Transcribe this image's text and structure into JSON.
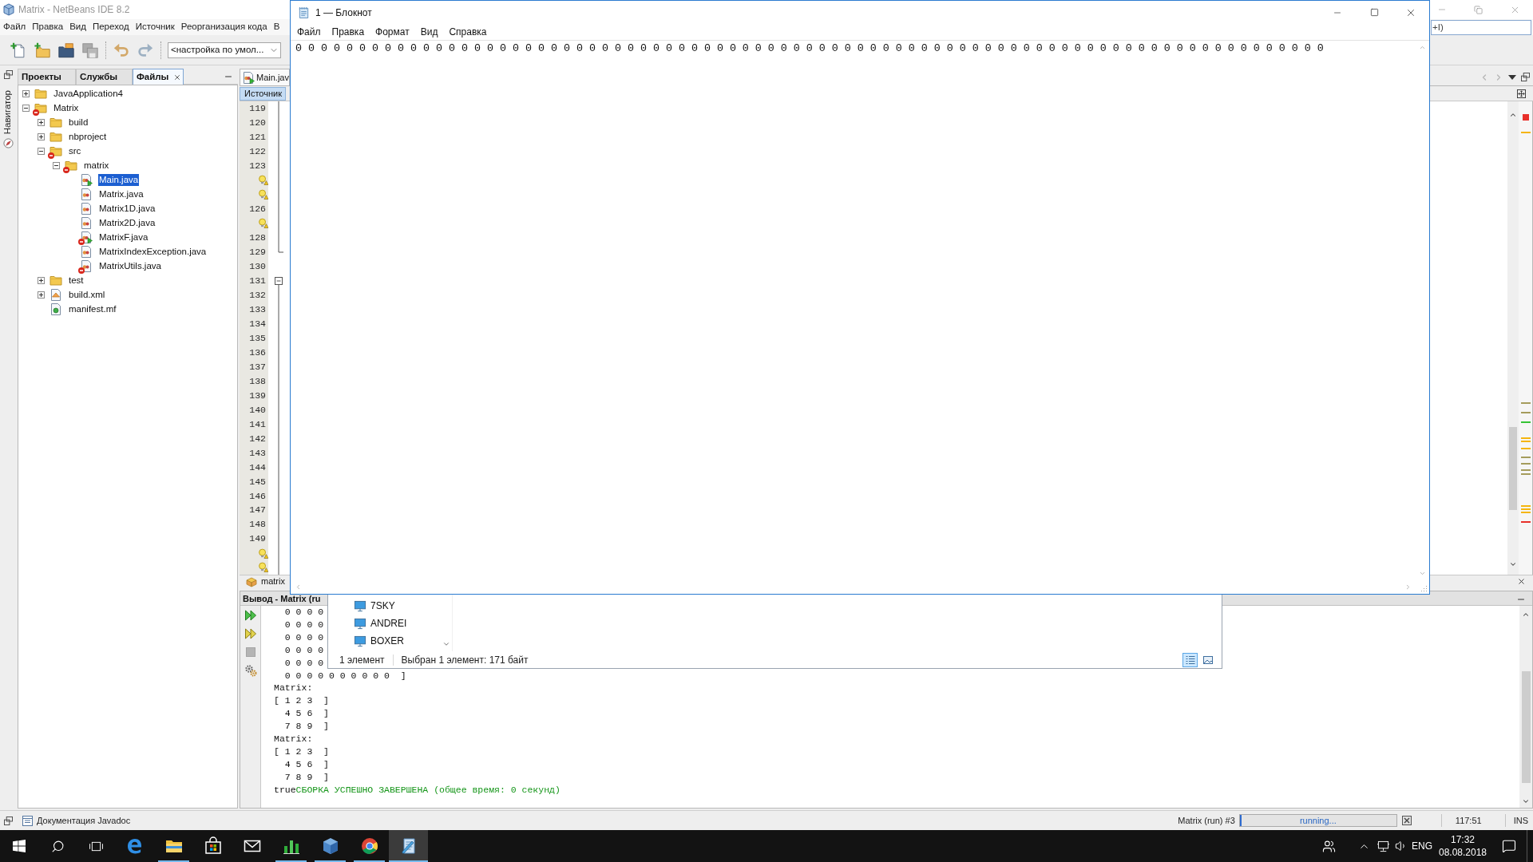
{
  "ide": {
    "title": "Matrix - NetBeans IDE 8.2",
    "menu": [
      "Файл",
      "Правка",
      "Вид",
      "Переход",
      "Источник",
      "Реорганизация кода",
      "В"
    ],
    "toolbar": {
      "buttons": [
        {
          "kind": "new-file",
          "disabled": false
        },
        {
          "kind": "new-project",
          "disabled": false
        },
        {
          "kind": "open-project",
          "disabled": false
        },
        {
          "kind": "save-all",
          "disabled": true
        },
        {
          "kind": "undo",
          "disabled": false
        },
        {
          "kind": "redo",
          "disabled": false
        }
      ],
      "configuration": "<настройка по умол..."
    },
    "search": {
      "placeholder": "+I)"
    },
    "side_tabs": [
      "Навигатор"
    ],
    "project_tabs": [
      {
        "label": "Проекты",
        "selected": false,
        "closable": false
      },
      {
        "label": "Службы",
        "selected": false,
        "closable": false
      },
      {
        "label": "Файлы",
        "selected": true,
        "closable": true
      }
    ],
    "tree": [
      {
        "label": "JavaApplication4",
        "kind": "folder",
        "expanded": false,
        "error": false,
        "selected": false
      },
      {
        "label": "Matrix",
        "kind": "folder",
        "expanded": true,
        "error": true,
        "selected": false,
        "children": [
          {
            "label": "build",
            "kind": "folder",
            "expanded": false,
            "error": false,
            "selected": false
          },
          {
            "label": "nbproject",
            "kind": "folder",
            "expanded": false,
            "error": false,
            "selected": false
          },
          {
            "label": "src",
            "kind": "folder",
            "expanded": true,
            "error": true,
            "selected": false,
            "children": [
              {
                "label": "matrix",
                "kind": "folder",
                "expanded": true,
                "error": true,
                "selected": false,
                "children": [
                  {
                    "label": "Main.java",
                    "kind": "java-main",
                    "error": false,
                    "selected": true
                  },
                  {
                    "label": "Matrix.java",
                    "kind": "java",
                    "error": false,
                    "selected": false
                  },
                  {
                    "label": "Matrix1D.java",
                    "kind": "java",
                    "error": false,
                    "selected": false
                  },
                  {
                    "label": "Matrix2D.java",
                    "kind": "java",
                    "error": false,
                    "selected": false
                  },
                  {
                    "label": "MatrixF.java",
                    "kind": "java-main",
                    "error": true,
                    "selected": false
                  },
                  {
                    "label": "MatrixIndexException.java",
                    "kind": "java",
                    "error": false,
                    "selected": false
                  },
                  {
                    "label": "MatrixUtils.java",
                    "kind": "java",
                    "error": true,
                    "selected": false
                  }
                ]
              }
            ]
          },
          {
            "label": "test",
            "kind": "folder",
            "expanded": false,
            "error": false,
            "selected": false
          },
          {
            "label": "build.xml",
            "kind": "xml",
            "expanded": false,
            "error": false,
            "selected": false
          },
          {
            "label": "manifest.mf",
            "kind": "manifest",
            "error": false,
            "selected": false
          }
        ]
      }
    ],
    "editor": {
      "file_tab": "Main.jav",
      "view_tab": {
        "label": "Источник",
        "selected": true
      },
      "gutter": [
        {
          "kind": "number",
          "text": "119"
        },
        {
          "kind": "number",
          "text": "120"
        },
        {
          "kind": "number",
          "text": "121"
        },
        {
          "kind": "number",
          "text": "122"
        },
        {
          "kind": "number",
          "text": "123"
        },
        {
          "kind": "hint"
        },
        {
          "kind": "hint"
        },
        {
          "kind": "number",
          "text": "126"
        },
        {
          "kind": "hint"
        },
        {
          "kind": "number",
          "text": "128"
        },
        {
          "kind": "number",
          "text": "129"
        },
        {
          "kind": "number",
          "text": "130"
        },
        {
          "kind": "number",
          "text": "131"
        },
        {
          "kind": "number",
          "text": "132"
        },
        {
          "kind": "number",
          "text": "133"
        },
        {
          "kind": "number",
          "text": "134"
        },
        {
          "kind": "number",
          "text": "135"
        },
        {
          "kind": "number",
          "text": "136"
        },
        {
          "kind": "number",
          "text": "137"
        },
        {
          "kind": "number",
          "text": "138"
        },
        {
          "kind": "number",
          "text": "139"
        },
        {
          "kind": "number",
          "text": "140"
        },
        {
          "kind": "number",
          "text": "141"
        },
        {
          "kind": "number",
          "text": "142"
        },
        {
          "kind": "number",
          "text": "143"
        },
        {
          "kind": "number",
          "text": "144"
        },
        {
          "kind": "number",
          "text": "145"
        },
        {
          "kind": "number",
          "text": "146"
        },
        {
          "kind": "number",
          "text": "147"
        },
        {
          "kind": "number",
          "text": "148"
        },
        {
          "kind": "number",
          "text": "149"
        },
        {
          "kind": "hint"
        },
        {
          "kind": "hint"
        }
      ],
      "breadcrumb": "matrix"
    },
    "output": {
      "title": "Вывод - Matrix (ru",
      "tools": [
        {
          "kind": "rerun",
          "disabled": false
        },
        {
          "kind": "rerun-custom",
          "disabled": false
        },
        {
          "kind": "stop",
          "disabled": true
        },
        {
          "kind": "settings",
          "disabled": false
        }
      ],
      "lines": [
        {
          "kind": "plain",
          "text": "  0 0 0 0"
        },
        {
          "kind": "plain",
          "text": "  0 0 0 0"
        },
        {
          "kind": "plain",
          "text": "  0 0 0 0"
        },
        {
          "kind": "plain",
          "text": "  0 0 0 0"
        },
        {
          "kind": "plain",
          "text": "  0 0 0 0"
        },
        {
          "kind": "plain",
          "text": "  0 0 0 0 0 0 0 0 0 0  ]"
        },
        {
          "kind": "plain",
          "text": "Matrix:"
        },
        {
          "kind": "plain",
          "text": "[ 1 2 3  ]"
        },
        {
          "kind": "plain",
          "text": "  4 5 6  ]"
        },
        {
          "kind": "plain",
          "text": "  7 8 9  ]"
        },
        {
          "kind": "plain",
          "text": "Matrix:"
        },
        {
          "kind": "plain",
          "text": "[ 1 2 3  ]"
        },
        {
          "kind": "plain",
          "text": "  4 5 6  ]"
        },
        {
          "kind": "plain",
          "text": "  7 8 9  ]"
        },
        {
          "kind": "result",
          "prefix": "true",
          "text": "СБОРКА УСПЕШНО ЗАВЕРШЕНА (общее время: 0 секунд)"
        }
      ]
    },
    "status_bar": {
      "text": "Документация Javadoc",
      "task": "Matrix (run) #3",
      "progress": {
        "label": "running...",
        "level": 0.01
      },
      "position": "117:51",
      "mode": "INS"
    }
  },
  "notepad": {
    "title": "1 — Блокнот",
    "menu": [
      "Файл",
      "Правка",
      "Формат",
      "Вид",
      "Справка"
    ],
    "text": "0 0 0 0 0 0 0 0 0 0 0 0 0 0 0 0 0 0 0 0 0 0 0 0 0 0 0 0 0 0 0 0 0 0 0 0 0 0 0 0 0 0 0 0 0 0 0 0 0 0 0 0 0 0 0 0 0 0 0 0 0 0 0 0 0 0 0 0 0 0 0 0 0 0 0 0 0 0 0 0 0"
  },
  "explorer": {
    "nav_items": [
      "7SKY",
      "ANDREI",
      "BOXER"
    ],
    "item_count": "1 элемент",
    "selection": "Выбран 1 элемент: 171 байт",
    "views": [
      {
        "kind": "details",
        "selected": true
      },
      {
        "kind": "large-icons",
        "selected": false
      }
    ]
  },
  "taskbar": {
    "apps": [
      {
        "kind": "e-browser",
        "running": false,
        "selected": false
      },
      {
        "kind": "folder",
        "running": true,
        "selected": false
      },
      {
        "kind": "store",
        "running": false,
        "selected": false
      },
      {
        "kind": "mail",
        "running": false,
        "selected": false
      },
      {
        "kind": "bars",
        "running": true,
        "selected": false
      },
      {
        "kind": "cube",
        "running": true,
        "selected": false
      },
      {
        "kind": "circle",
        "running": true,
        "selected": false
      },
      {
        "kind": "notepad",
        "running": true,
        "selected": true
      }
    ],
    "language": "ENG",
    "time": "17:32",
    "date": "08.08.2018"
  }
}
